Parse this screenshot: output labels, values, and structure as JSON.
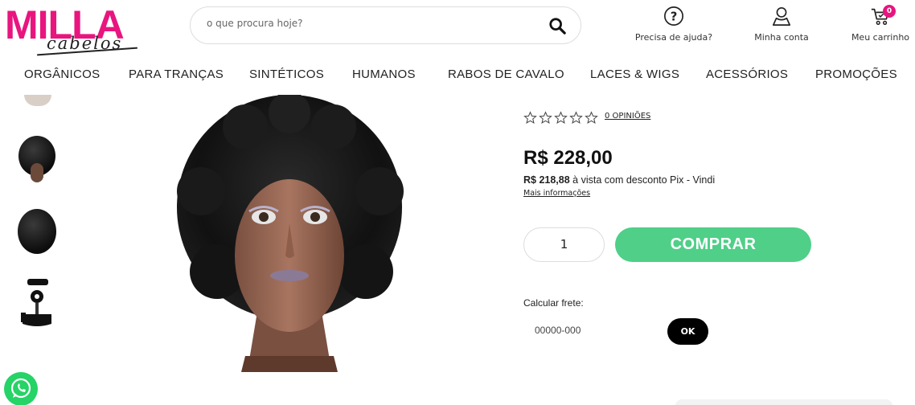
{
  "brand": {
    "name": "MILLA",
    "script": "cabelos"
  },
  "search": {
    "placeholder": "o que procura hoje?"
  },
  "header": {
    "help_label": "Precisa de ajuda?",
    "account_label": "Minha conta",
    "cart_label": "Meu carrinho",
    "cart_count": "0"
  },
  "nav": [
    "ORGÂNICOS",
    "PARA TRANÇAS",
    "SINTÉTICOS",
    "HUMANOS",
    "RABOS DE CAVALO",
    "LACES & WIGS",
    "ACESSÓRIOS",
    "PROMOÇÕES"
  ],
  "product": {
    "reviews": "0 OPINIÕES",
    "rating": 0,
    "price": "R$ 228,00",
    "pix_price": "R$ 218,88",
    "pix_text": " à vista com desconto Pix - Vindi",
    "more_info": "Mais informações",
    "quantity": "1",
    "buy_label": "COMPRAR",
    "shipping_label": "Calcular frete:",
    "cep_placeholder": "00000-000",
    "ok_label": "OK"
  },
  "colors": {
    "brand_pink": "#e8157f",
    "buy_green": "#4fcf88"
  }
}
